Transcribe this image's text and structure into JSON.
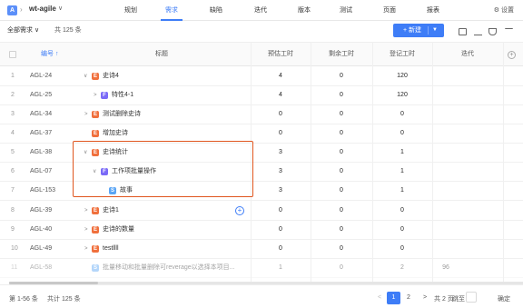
{
  "app": {
    "project": "wt-agile"
  },
  "nav": [
    {
      "label": "规划",
      "active": false
    },
    {
      "label": "需求",
      "active": true
    },
    {
      "label": "缺陷",
      "active": false
    },
    {
      "label": "迭代",
      "active": false
    },
    {
      "label": "版本",
      "active": false
    },
    {
      "label": "测试",
      "active": false
    },
    {
      "label": "页面",
      "active": false
    },
    {
      "label": "报表",
      "active": false
    }
  ],
  "settings_label": "设置",
  "toolbar": {
    "filter": "全部需求 ∨",
    "count": "共 125 条",
    "new_label": "+ 新建"
  },
  "columns": {
    "id": "编号 ↑",
    "title": "标题",
    "estimate": "预估工时",
    "remaining": "剩余工时",
    "logged": "登记工时",
    "sprint": "迭代"
  },
  "rows": [
    {
      "n": "1",
      "id": "AGL-24",
      "toggle": "∨",
      "type": "E",
      "title": "史诗4",
      "est": "4",
      "rem": "0",
      "log": "120",
      "sprint": ""
    },
    {
      "n": "2",
      "id": "AGL-25",
      "toggle": ">",
      "type": "F",
      "title": "特性4-1",
      "est": "4",
      "rem": "0",
      "log": "120",
      "sprint": ""
    },
    {
      "n": "3",
      "id": "AGL-34",
      "toggle": ">",
      "type": "E",
      "title": "测试删除史诗",
      "est": "0",
      "rem": "0",
      "log": "0",
      "sprint": ""
    },
    {
      "n": "4",
      "id": "AGL-37",
      "toggle": "",
      "type": "E",
      "title": "增加史诗",
      "est": "0",
      "rem": "0",
      "log": "0",
      "sprint": ""
    },
    {
      "n": "5",
      "id": "AGL-38",
      "toggle": "∨",
      "type": "E",
      "title": "史诗统计",
      "est": "3",
      "rem": "0",
      "log": "1",
      "sprint": ""
    },
    {
      "n": "6",
      "id": "AGL-07",
      "toggle": "∨",
      "type": "F",
      "title": "工作项批量操作",
      "est": "3",
      "rem": "0",
      "log": "1",
      "sprint": ""
    },
    {
      "n": "7",
      "id": "AGL-153",
      "toggle": "",
      "type": "S",
      "title": "故事",
      "est": "3",
      "rem": "0",
      "log": "1",
      "sprint": ""
    },
    {
      "n": "8",
      "id": "AGL-39",
      "toggle": ">",
      "type": "E",
      "title": "史诗1",
      "est": "0",
      "rem": "0",
      "log": "0",
      "sprint": ""
    },
    {
      "n": "9",
      "id": "AGL-40",
      "toggle": ">",
      "type": "E",
      "title": "史诗的数量",
      "est": "0",
      "rem": "0",
      "log": "0",
      "sprint": ""
    },
    {
      "n": "10",
      "id": "AGL-49",
      "toggle": ">",
      "type": "E",
      "title": "testllll",
      "est": "0",
      "rem": "0",
      "log": "0",
      "sprint": ""
    },
    {
      "n": "11",
      "id": "AGL-58",
      "toggle": "",
      "type": "S",
      "title": "批量移动和批量删除可reverage以选择本项目...",
      "est": "1",
      "rem": "0",
      "log": "2",
      "sprint": "96"
    }
  ],
  "footer": {
    "range": "第 1-56 条",
    "total": "共计 125 条",
    "prev": "<",
    "page1": "1",
    "page2": "2",
    "next": ">",
    "pages": "共 2 页",
    "goto": "跳至",
    "confirm": "确定"
  },
  "colors": {
    "accent": "#3e7df7",
    "epic": "#f0703d",
    "feature": "#7a6af7",
    "story": "#5aa5f5",
    "highlight": "#e0561f"
  }
}
